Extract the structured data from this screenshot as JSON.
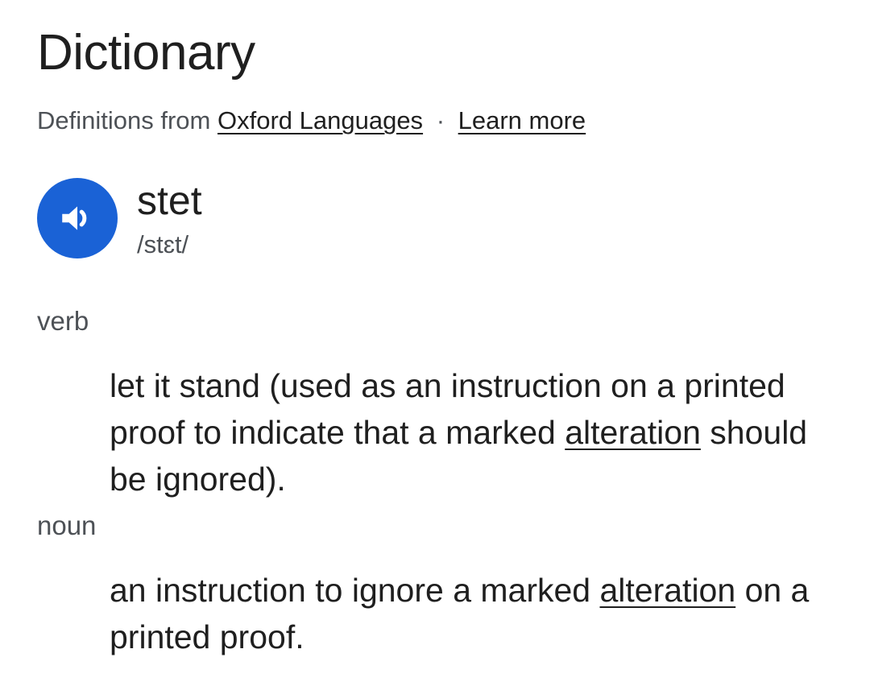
{
  "panel": {
    "title": "Dictionary",
    "attribution_prefix": "Definitions from",
    "source_link": "Oxford Languages",
    "separator": "·",
    "learn_more_link": "Learn more"
  },
  "entry": {
    "word": "stet",
    "pronunciation": "/stɛt/",
    "audio_icon": "speaker-icon",
    "accent_color": "#1a62d6"
  },
  "senses": [
    {
      "part_of_speech": "verb",
      "definition_before_link": "let it stand (used as an instruction on a printed proof to indicate that a marked ",
      "definition_link": "alteration",
      "definition_after_link": " should be ignored)."
    },
    {
      "part_of_speech": "noun",
      "definition_before_link": "an instruction to ignore a marked ",
      "definition_link": "alteration",
      "definition_after_link": " on a printed proof."
    }
  ]
}
